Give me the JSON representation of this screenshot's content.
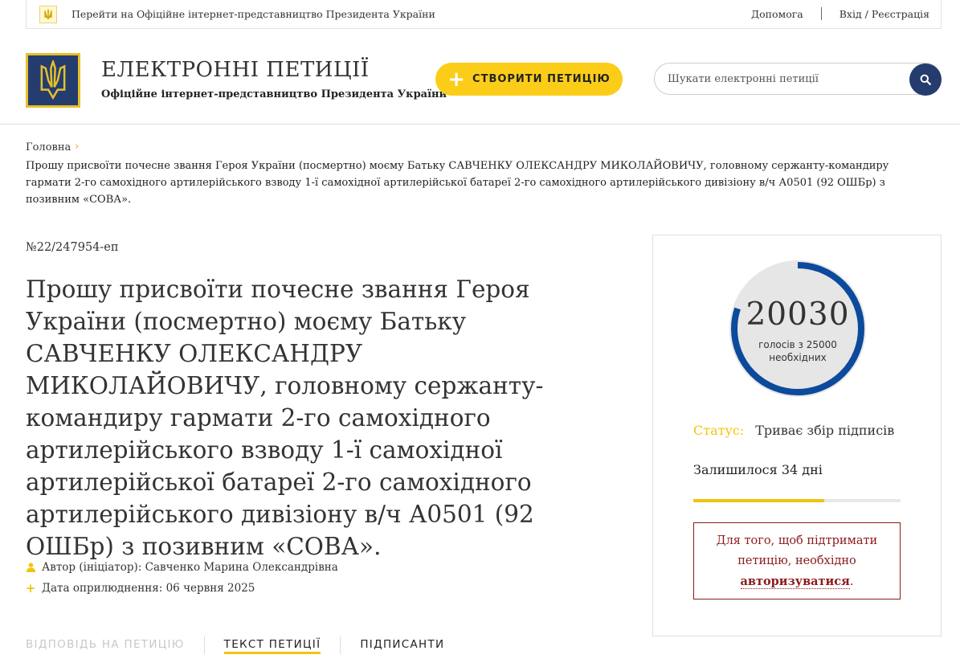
{
  "topbar": {
    "president_link": "Перейти на Офіційне інтернет-представництво Президента України",
    "help_link": "Допомога",
    "login": "Вхід",
    "login_sep": "/",
    "register": "Реєстрація"
  },
  "header": {
    "title": "ЕЛЕКТРОННІ ПЕТИЦІЇ",
    "subtitle": "Офіційне інтернет-представництво Президента України",
    "create_button": "СТВОРИТИ ПЕТИЦІЮ",
    "search_placeholder": "Шукати електронні петиції"
  },
  "breadcrumb": {
    "home": "Головна",
    "current": "Прошу присвоїти почесне звання Героя України (посмертно) моєму Батьку САВЧЕНКУ ОЛЕКСАНДРУ МИКОЛАЙОВИЧУ, головному сержанту-командиру гармати 2-го самохідного артилерійського взводу 1-ї самохідної артилерійської батареї 2-го самохідного артилерійського дивізіону в/ч А0501 (92 ОШБр) з позивним «СОВА»."
  },
  "petition": {
    "number": "№22/247954-еп",
    "title": "Прошу присвоїти почесне звання Героя України (посмертно) моєму Батьку САВЧЕНКУ ОЛЕКСАНДРУ МИКОЛАЙОВИЧУ, головному сержанту-командиру гармати 2-го самохідного артилерійського взводу 1-ї самохідної артилерійської батареї 2-го самохідного артилерійського дивізіону в/ч А0501 (92 ОШБр) з позивним «СОВА».",
    "author_label": "Автор (ініціатор):",
    "author": "Савченко Марина Олександрівна",
    "date_label": "Дата оприлюднення:",
    "date": "06 червня 2025"
  },
  "tabs": [
    {
      "label": "ВІДПОВІДЬ НА ПЕТИЦІЮ",
      "state": "disabled"
    },
    {
      "label": "ТЕКСТ ПЕТИЦІЇ",
      "state": "active"
    },
    {
      "label": "ПІДПИСАНТИ",
      "state": "normal"
    }
  ],
  "votes": {
    "count": "20030",
    "caption_line1": "голосів з 25000",
    "caption_line2": "необхідних",
    "count_value": 20030,
    "needed_value": 25000,
    "status_label": "Статус:",
    "status_value": "Триває збір підписів",
    "remaining": "Залишилося 34 дні",
    "days_progress_fraction": 0.63,
    "auth_text": "Для того, щоб підтримати петицію, необхідно",
    "auth_link": "авторизуватися",
    "auth_end": "."
  },
  "colors": {
    "brand_navy": "#243c6e",
    "accent_yellow": "#fbcd18",
    "ring_blue": "#0c4a9c",
    "alert_red": "#8b1a1a"
  },
  "icons": {
    "author": "user-icon",
    "date": "plus-icon",
    "search": "search-icon",
    "logo": "trident-icon"
  }
}
